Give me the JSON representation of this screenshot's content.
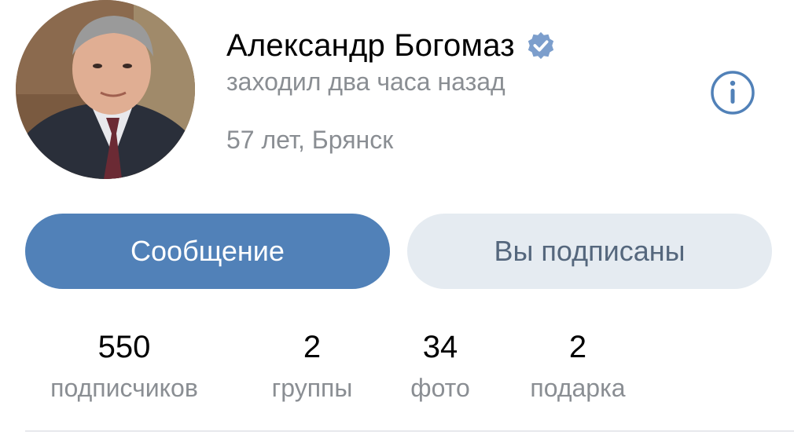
{
  "profile": {
    "name": "Александр Богомаз",
    "verified_icon": "verified-check-icon",
    "status": "заходил два часа назад",
    "location": "57 лет, Брянск",
    "info_icon": "info-icon"
  },
  "actions": {
    "message_label": "Сообщение",
    "subscribed_label": "Вы подписаны"
  },
  "stats": [
    {
      "value": "550",
      "label": "подписчиков"
    },
    {
      "value": "2",
      "label": "группы"
    },
    {
      "value": "34",
      "label": "фото"
    },
    {
      "value": "2",
      "label": "подарка"
    }
  ],
  "colors": {
    "accent": "#5181b8",
    "secondary_button_bg": "#e5ebf1",
    "secondary_button_text": "#55677d",
    "muted_text": "#8a8e93",
    "verified_badge": "#7c9ecc"
  }
}
